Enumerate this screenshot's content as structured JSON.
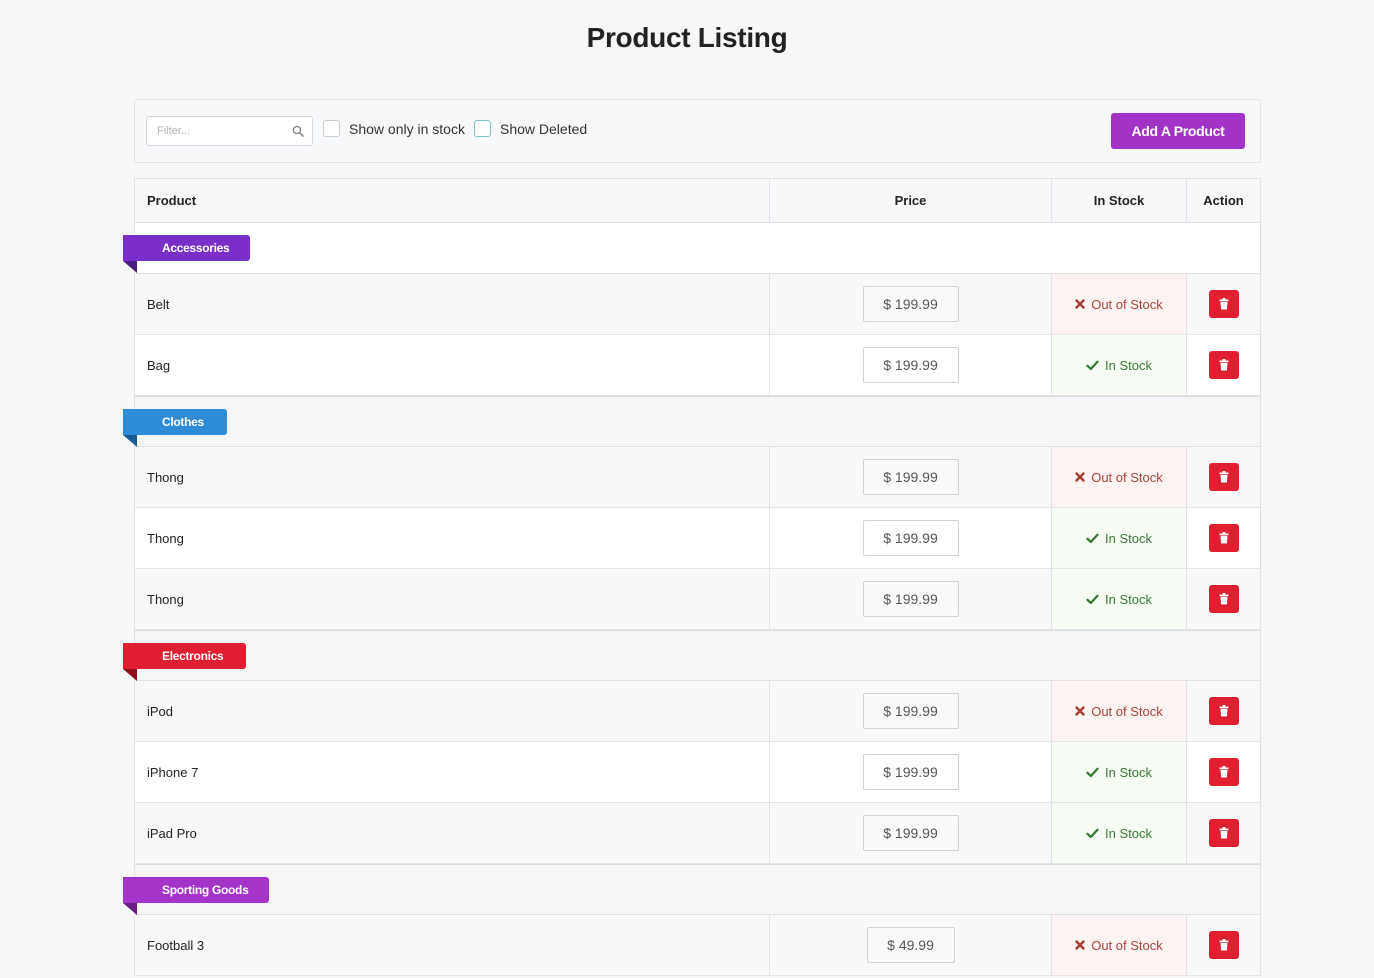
{
  "page": {
    "title": "Product Listing"
  },
  "toolbar": {
    "filter_placeholder": "Filter...",
    "show_in_stock_label": "Show only in stock",
    "show_deleted_label": "Show Deleted",
    "add_button_label": "Add A Product",
    "accent_color": "#a233c6"
  },
  "table": {
    "headers": {
      "product": "Product",
      "price": "Price",
      "stock": "In Stock",
      "action": "Action"
    },
    "categories": [
      {
        "name": "Accessories",
        "color": "#7a30c8",
        "fold_color": "#4b1c85",
        "products": [
          {
            "name": "Belt",
            "price": "$ 199.99",
            "stock": "Out of Stock",
            "in_stock": false
          },
          {
            "name": "Bag",
            "price": "$ 199.99",
            "stock": "In Stock",
            "in_stock": true
          }
        ]
      },
      {
        "name": "Clothes",
        "color": "#2d8bd8",
        "fold_color": "#1b5a94",
        "products": [
          {
            "name": "Thong",
            "price": "$ 199.99",
            "stock": "Out of Stock",
            "in_stock": false
          },
          {
            "name": "Thong",
            "price": "$ 199.99",
            "stock": "In Stock",
            "in_stock": true
          },
          {
            "name": "Thong",
            "price": "$ 199.99",
            "stock": "In Stock",
            "in_stock": true
          }
        ]
      },
      {
        "name": "Electronics",
        "color": "#e01e2f",
        "fold_color": "#8f0f1b",
        "products": [
          {
            "name": "iPod",
            "price": "$ 199.99",
            "stock": "Out of Stock",
            "in_stock": false
          },
          {
            "name": "iPhone 7",
            "price": "$ 199.99",
            "stock": "In Stock",
            "in_stock": true
          },
          {
            "name": "iPad Pro",
            "price": "$ 199.99",
            "stock": "In Stock",
            "in_stock": true
          }
        ]
      },
      {
        "name": "Sporting Goods",
        "color": "#a433c8",
        "fold_color": "#6a1d85",
        "products": [
          {
            "name": "Football 3",
            "price": "$ 49.99",
            "stock": "Out of Stock",
            "in_stock": false
          }
        ]
      }
    ]
  },
  "icons": {
    "search": "search-icon",
    "out_of_stock": "x-mark-icon",
    "in_stock": "check-icon",
    "delete": "trash-icon"
  }
}
